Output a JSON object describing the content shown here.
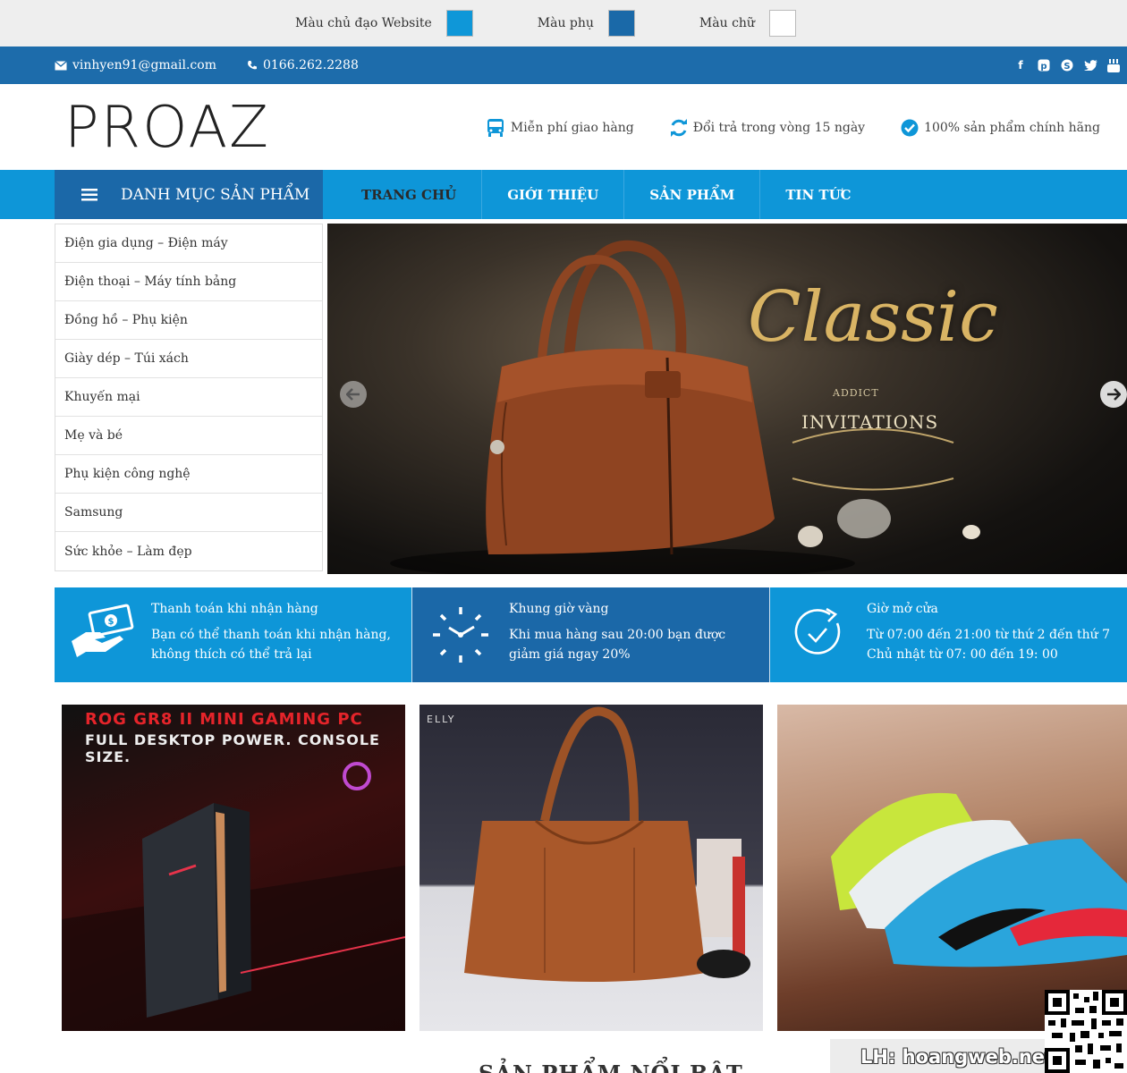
{
  "color_bar": {
    "main_label": "Màu chủ đạo Website",
    "secondary_label": "Màu phụ",
    "text_label": "Màu chữ",
    "main_color": "#0f97d8",
    "secondary_color": "#1a69a8",
    "text_color": "#ffffff"
  },
  "topbar": {
    "email": "vinhyen91@gmail.com",
    "phone": "0166.262.2288",
    "socials": [
      "facebook-icon",
      "pinterest-icon",
      "skype-icon",
      "twitter-icon",
      "youtube-icon"
    ]
  },
  "header": {
    "logo": "PROAZ",
    "features": [
      {
        "icon": "bus-icon",
        "label": "Miễn phí giao hàng"
      },
      {
        "icon": "refresh-icon",
        "label": "Đổi trả trong vòng 15 ngày"
      },
      {
        "icon": "check-circle-icon",
        "label": "100% sản phẩm chính hãng"
      }
    ]
  },
  "nav": {
    "category_button": "DANH MỤC SẢN PHẨM",
    "menu": [
      "TRANG CHỦ",
      "GIỚI THIỆU",
      "SẢN PHẨM",
      "TIN TỨC"
    ]
  },
  "categories": [
    "Điện gia dụng – Điện máy",
    "Điện thoại – Máy tính bảng",
    "Đồng hồ – Phụ kiện",
    "Giày dép – Túi xách",
    "Khuyến mại",
    "Mẹ và bé",
    "Phụ kiện công nghệ",
    "Samsung",
    "Sức khỏe – Làm đẹp"
  ],
  "slider": {
    "title": "Classic",
    "sub": "ADDICT",
    "sub2": "INVITATIONS"
  },
  "services": [
    {
      "title": "Thanh toán khi nhận hàng",
      "desc": "Bạn có thể thanh toán khi nhận hàng, không thích có thể trả lại"
    },
    {
      "title": "Khung giờ vàng",
      "desc": "Khi mua hàng sau 20:00 bạn được giảm giá ngay 20%"
    },
    {
      "title": "Giờ mở cửa",
      "desc": "Từ 07:00 đến 21:00 từ thứ 2 đến thứ 7 Chủ nhật từ 07: 00 đến 19: 00"
    }
  ],
  "promos": {
    "p1_line1": "ROG GR8 II MINI GAMING PC",
    "p1_line2": "FULL DESKTOP POWER. CONSOLE SIZE.",
    "p2_brand": "ELLY"
  },
  "section_heading": "SẢN PHẨM NỔI BẬT",
  "watermark": "LH: hoangweb.net"
}
